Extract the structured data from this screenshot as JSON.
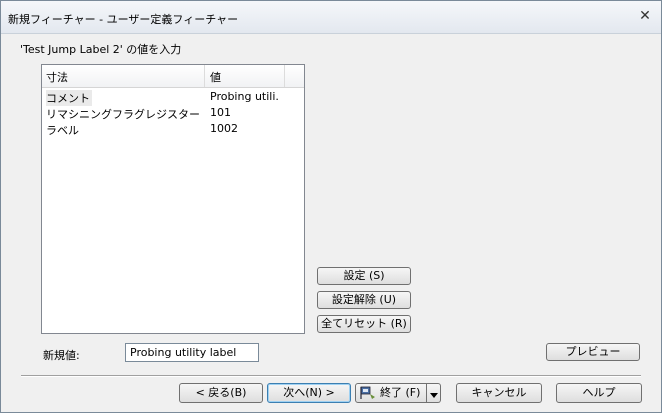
{
  "window": {
    "title": "新規フィーチャー - ユーザー定義フィーチャー",
    "close_glyph": "✕"
  },
  "prompt": "'Test Jump Label 2' の値を入力",
  "table": {
    "headers": [
      "寸法",
      "値"
    ],
    "rows": [
      {
        "name": "コメント",
        "value": "Probing utili..."
      },
      {
        "name": "リマシニングフラグレジスター",
        "value": "101"
      },
      {
        "name": "ラベル",
        "value": "1002"
      }
    ]
  },
  "side_buttons": {
    "set": "設定 (S)",
    "unset": "設定解除 (U)",
    "reset_all": "全てリセット (R)",
    "preview": "プレビュー"
  },
  "new_value": {
    "label": "新規値:",
    "value": "Probing utility label"
  },
  "bottom_buttons": {
    "back": "< 戻る(B)",
    "next": "次へ(N) >",
    "finish": "終了 (F)",
    "cancel": "キャンセル",
    "help": "ヘルプ"
  },
  "icons": {
    "finish": "flag-icon",
    "dropdown": "dropdown-arrow-icon",
    "close": "close-icon"
  }
}
